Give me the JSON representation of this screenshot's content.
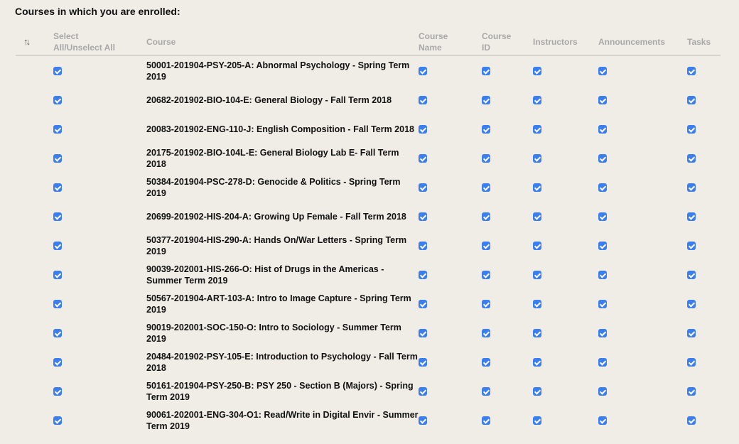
{
  "heading": "Courses in which you are enrolled:",
  "columns": {
    "sort_icon": "sort-arrows-icon",
    "select_line1": "Select",
    "select_line2": "All/Unselect All",
    "course": "Course",
    "course_name_line1": "Course",
    "course_name_line2": "Name",
    "course_id_line1": "Course",
    "course_id_line2": "ID",
    "instructors": "Instructors",
    "announcements": "Announcements",
    "tasks": "Tasks"
  },
  "colors": {
    "checkbox": "#3b7ef0",
    "background": "#efede6",
    "header_text": "#a8a8a8"
  },
  "courses": [
    {
      "title": "50001-201904-PSY-205-A: Abnormal Psychology - Spring Term 2019",
      "select": true,
      "course_name": true,
      "course_id": true,
      "instructors": true,
      "announcements": true,
      "tasks": true
    },
    {
      "title": "20682-201902-BIO-104-E: General Biology - Fall Term 2018",
      "select": true,
      "course_name": true,
      "course_id": true,
      "instructors": true,
      "announcements": true,
      "tasks": true
    },
    {
      "title": "20083-201902-ENG-110-J: English Composition - Fall Term 2018",
      "select": true,
      "course_name": true,
      "course_id": true,
      "instructors": true,
      "announcements": true,
      "tasks": true
    },
    {
      "title": "20175-201902-BIO-104L-E: General Biology Lab E- Fall Term 2018",
      "select": true,
      "course_name": true,
      "course_id": true,
      "instructors": true,
      "announcements": true,
      "tasks": true
    },
    {
      "title": "50384-201904-PSC-278-D: Genocide & Politics - Spring Term 2019",
      "select": true,
      "course_name": true,
      "course_id": true,
      "instructors": true,
      "announcements": true,
      "tasks": true
    },
    {
      "title": "20699-201902-HIS-204-A: Growing Up Female - Fall Term 2018",
      "select": true,
      "course_name": true,
      "course_id": true,
      "instructors": true,
      "announcements": true,
      "tasks": true
    },
    {
      "title": "50377-201904-HIS-290-A: Hands On/War Letters - Spring Term 2019",
      "select": true,
      "course_name": true,
      "course_id": true,
      "instructors": true,
      "announcements": true,
      "tasks": true
    },
    {
      "title": "90039-202001-HIS-266-O: Hist of Drugs in the Americas - Summer Term 2019",
      "select": true,
      "course_name": true,
      "course_id": true,
      "instructors": true,
      "announcements": true,
      "tasks": true
    },
    {
      "title": "50567-201904-ART-103-A: Intro to Image Capture - Spring Term 2019",
      "select": true,
      "course_name": true,
      "course_id": true,
      "instructors": true,
      "announcements": true,
      "tasks": true
    },
    {
      "title": "90019-202001-SOC-150-O: Intro to Sociology - Summer Term 2019",
      "select": true,
      "course_name": true,
      "course_id": true,
      "instructors": true,
      "announcements": true,
      "tasks": true
    },
    {
      "title": "20484-201902-PSY-105-E: Introduction to Psychology - Fall Term 2018",
      "select": true,
      "course_name": true,
      "course_id": true,
      "instructors": true,
      "announcements": true,
      "tasks": true
    },
    {
      "title": "50161-201904-PSY-250-B: PSY 250 - Section B (Majors) - Spring Term 2019",
      "select": true,
      "course_name": true,
      "course_id": true,
      "instructors": true,
      "announcements": true,
      "tasks": true
    },
    {
      "title": "90061-202001-ENG-304-O1: Read/Write in Digital Envir - Summer Term 2019",
      "select": true,
      "course_name": true,
      "course_id": true,
      "instructors": true,
      "announcements": true,
      "tasks": true
    }
  ]
}
